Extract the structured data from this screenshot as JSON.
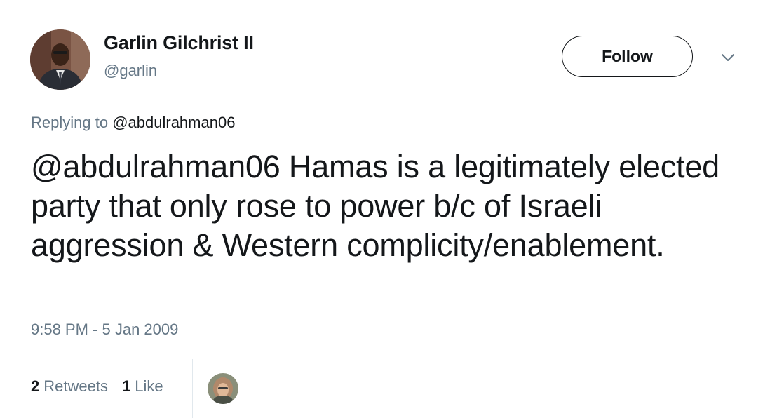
{
  "author": {
    "name": "Garlin Gilchrist II",
    "handle": "@garlin"
  },
  "follow_button": {
    "label": "Follow"
  },
  "reply": {
    "prefix": "Replying to",
    "target": "@abdulrahman06"
  },
  "tweet": {
    "text": "@abdulrahman06 Hamas is a legitimately elected party that only rose to power b/c of Israeli aggression & Western complicity/enablement.",
    "timestamp": "9:58 PM - 5 Jan 2009"
  },
  "stats": {
    "retweets_count": "2",
    "retweets_label": "Retweets",
    "likes_count": "1",
    "likes_label": "Like"
  },
  "icons": {
    "menu": "chevron-down-icon"
  },
  "colors": {
    "text": "#14171a",
    "secondary": "#657786",
    "divider": "#e1e8ed"
  }
}
